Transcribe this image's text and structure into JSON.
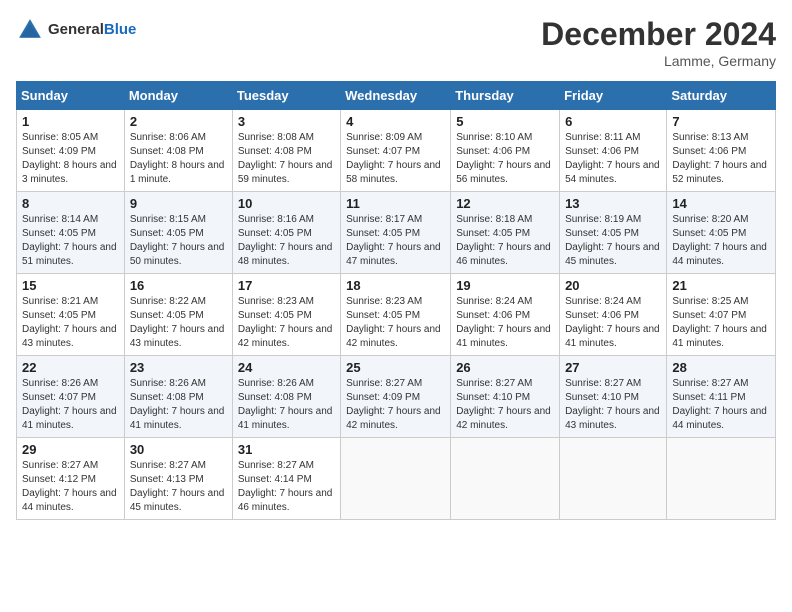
{
  "header": {
    "logo": {
      "text_general": "General",
      "text_blue": "Blue"
    },
    "title": "December 2024",
    "location": "Lamme, Germany"
  },
  "days_of_week": [
    "Sunday",
    "Monday",
    "Tuesday",
    "Wednesday",
    "Thursday",
    "Friday",
    "Saturday"
  ],
  "weeks": [
    [
      {
        "day": 1,
        "sunrise": "8:05 AM",
        "sunset": "4:09 PM",
        "daylight": "8 hours and 3 minutes."
      },
      {
        "day": 2,
        "sunrise": "8:06 AM",
        "sunset": "4:08 PM",
        "daylight": "8 hours and 1 minute."
      },
      {
        "day": 3,
        "sunrise": "8:08 AM",
        "sunset": "4:08 PM",
        "daylight": "7 hours and 59 minutes."
      },
      {
        "day": 4,
        "sunrise": "8:09 AM",
        "sunset": "4:07 PM",
        "daylight": "7 hours and 58 minutes."
      },
      {
        "day": 5,
        "sunrise": "8:10 AM",
        "sunset": "4:06 PM",
        "daylight": "7 hours and 56 minutes."
      },
      {
        "day": 6,
        "sunrise": "8:11 AM",
        "sunset": "4:06 PM",
        "daylight": "7 hours and 54 minutes."
      },
      {
        "day": 7,
        "sunrise": "8:13 AM",
        "sunset": "4:06 PM",
        "daylight": "7 hours and 52 minutes."
      }
    ],
    [
      {
        "day": 8,
        "sunrise": "8:14 AM",
        "sunset": "4:05 PM",
        "daylight": "7 hours and 51 minutes."
      },
      {
        "day": 9,
        "sunrise": "8:15 AM",
        "sunset": "4:05 PM",
        "daylight": "7 hours and 50 minutes."
      },
      {
        "day": 10,
        "sunrise": "8:16 AM",
        "sunset": "4:05 PM",
        "daylight": "7 hours and 48 minutes."
      },
      {
        "day": 11,
        "sunrise": "8:17 AM",
        "sunset": "4:05 PM",
        "daylight": "7 hours and 47 minutes."
      },
      {
        "day": 12,
        "sunrise": "8:18 AM",
        "sunset": "4:05 PM",
        "daylight": "7 hours and 46 minutes."
      },
      {
        "day": 13,
        "sunrise": "8:19 AM",
        "sunset": "4:05 PM",
        "daylight": "7 hours and 45 minutes."
      },
      {
        "day": 14,
        "sunrise": "8:20 AM",
        "sunset": "4:05 PM",
        "daylight": "7 hours and 44 minutes."
      }
    ],
    [
      {
        "day": 15,
        "sunrise": "8:21 AM",
        "sunset": "4:05 PM",
        "daylight": "7 hours and 43 minutes."
      },
      {
        "day": 16,
        "sunrise": "8:22 AM",
        "sunset": "4:05 PM",
        "daylight": "7 hours and 43 minutes."
      },
      {
        "day": 17,
        "sunrise": "8:23 AM",
        "sunset": "4:05 PM",
        "daylight": "7 hours and 42 minutes."
      },
      {
        "day": 18,
        "sunrise": "8:23 AM",
        "sunset": "4:05 PM",
        "daylight": "7 hours and 42 minutes."
      },
      {
        "day": 19,
        "sunrise": "8:24 AM",
        "sunset": "4:06 PM",
        "daylight": "7 hours and 41 minutes."
      },
      {
        "day": 20,
        "sunrise": "8:24 AM",
        "sunset": "4:06 PM",
        "daylight": "7 hours and 41 minutes."
      },
      {
        "day": 21,
        "sunrise": "8:25 AM",
        "sunset": "4:07 PM",
        "daylight": "7 hours and 41 minutes."
      }
    ],
    [
      {
        "day": 22,
        "sunrise": "8:26 AM",
        "sunset": "4:07 PM",
        "daylight": "7 hours and 41 minutes."
      },
      {
        "day": 23,
        "sunrise": "8:26 AM",
        "sunset": "4:08 PM",
        "daylight": "7 hours and 41 minutes."
      },
      {
        "day": 24,
        "sunrise": "8:26 AM",
        "sunset": "4:08 PM",
        "daylight": "7 hours and 41 minutes."
      },
      {
        "day": 25,
        "sunrise": "8:27 AM",
        "sunset": "4:09 PM",
        "daylight": "7 hours and 42 minutes."
      },
      {
        "day": 26,
        "sunrise": "8:27 AM",
        "sunset": "4:10 PM",
        "daylight": "7 hours and 42 minutes."
      },
      {
        "day": 27,
        "sunrise": "8:27 AM",
        "sunset": "4:10 PM",
        "daylight": "7 hours and 43 minutes."
      },
      {
        "day": 28,
        "sunrise": "8:27 AM",
        "sunset": "4:11 PM",
        "daylight": "7 hours and 44 minutes."
      }
    ],
    [
      {
        "day": 29,
        "sunrise": "8:27 AM",
        "sunset": "4:12 PM",
        "daylight": "7 hours and 44 minutes."
      },
      {
        "day": 30,
        "sunrise": "8:27 AM",
        "sunset": "4:13 PM",
        "daylight": "7 hours and 45 minutes."
      },
      {
        "day": 31,
        "sunrise": "8:27 AM",
        "sunset": "4:14 PM",
        "daylight": "7 hours and 46 minutes."
      },
      null,
      null,
      null,
      null
    ]
  ]
}
